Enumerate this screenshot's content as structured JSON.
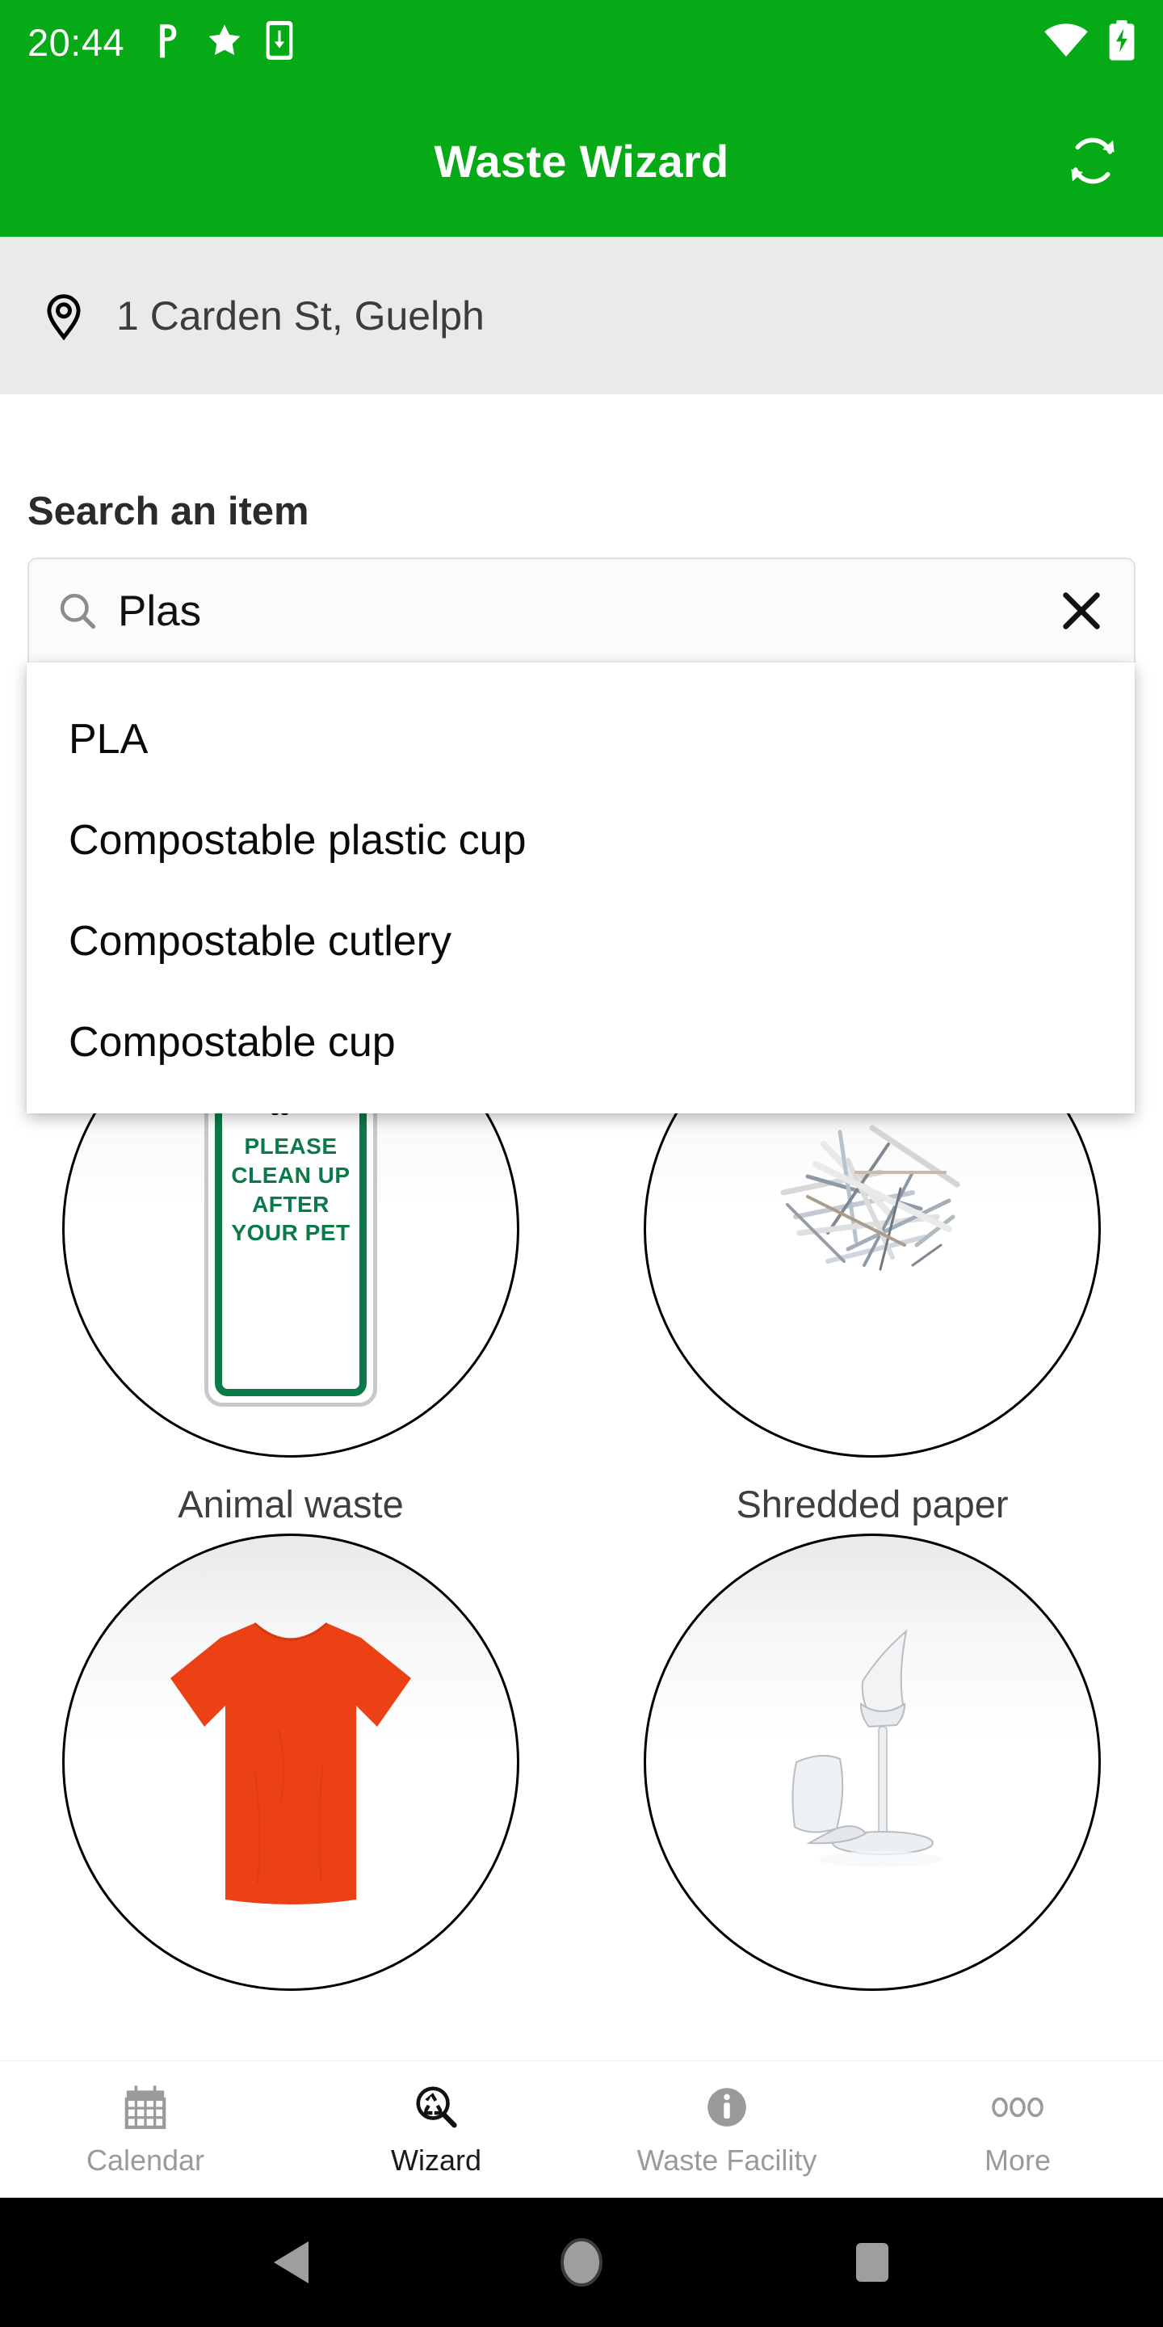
{
  "statusbar": {
    "time": "20:44",
    "icons_left": [
      "parking-p-icon",
      "star-icon",
      "phone-download-icon"
    ],
    "icons_right": [
      "wifi-icon",
      "battery-charging-icon"
    ],
    "background_color": "#06A916"
  },
  "appbar": {
    "title": "Waste Wizard",
    "action_icon": "refresh-sync-icon",
    "background_color": "#06A916",
    "text_color": "#FFFFFF"
  },
  "address": {
    "icon": "location-pin-icon",
    "text": "1 Carden St, Guelph",
    "background_color": "#EAEAEA"
  },
  "search": {
    "label": "Search an item",
    "icon": "search-icon",
    "value": "Plas",
    "placeholder": "Search an item",
    "clear_icon": "close-x-icon"
  },
  "suggestions": {
    "items": [
      {
        "label": "PLA"
      },
      {
        "label": "Compostable plastic cup"
      },
      {
        "label": "Compostable cutlery"
      },
      {
        "label": "Compostable cup"
      }
    ]
  },
  "grid": {
    "tiles": [
      {
        "label": "Animal waste",
        "image": "pet-waste-sign-image",
        "sign_lines": [
          "PLEASE",
          "CLEAN UP",
          "AFTER",
          "YOUR PET"
        ],
        "sign_color": "#0A7A48"
      },
      {
        "label": "Shredded paper",
        "image": "shredded-paper-image"
      },
      {
        "label": "",
        "image": "orange-tshirt-image",
        "accent_color": "#EC4015"
      },
      {
        "label": "",
        "image": "broken-glass-image"
      }
    ]
  },
  "bottomnav": {
    "items": [
      {
        "label": "Calendar",
        "icon": "calendar-icon",
        "active": false
      },
      {
        "label": "Wizard",
        "icon": "recycle-magnifier-icon",
        "active": true
      },
      {
        "label": "Waste Facility",
        "icon": "info-circle-icon",
        "active": false
      },
      {
        "label": "More",
        "icon": "three-dots-icon",
        "active": false
      }
    ]
  },
  "sysnav": {
    "back": "back-triangle-icon",
    "home": "home-circle-icon",
    "recents": "recents-square-icon"
  }
}
